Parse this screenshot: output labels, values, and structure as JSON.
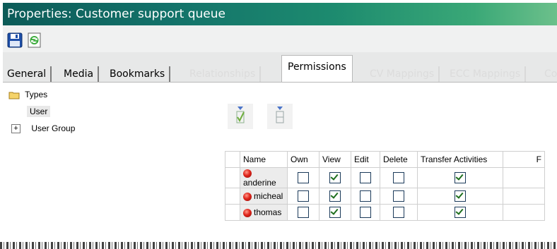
{
  "window": {
    "title": "Properties: Customer support queue"
  },
  "toolbar": {
    "save_icon": "save-icon",
    "refresh_icon": "refresh-icon"
  },
  "tabs": [
    {
      "label": "General",
      "state": "normal"
    },
    {
      "label": "Media",
      "state": "normal"
    },
    {
      "label": "Bookmarks",
      "state": "normal"
    },
    {
      "label": "Relationships",
      "state": "disabled"
    },
    {
      "label": "Permissions",
      "state": "active"
    },
    {
      "label": "CV Mappings",
      "state": "disabled"
    },
    {
      "label": "ECC Mappings",
      "state": "disabled"
    },
    {
      "label": "Co",
      "state": "disabled"
    }
  ],
  "tree": {
    "root": "Types",
    "items": [
      {
        "label": "User",
        "selected": true
      },
      {
        "label": "User Group",
        "expandable": true
      }
    ]
  },
  "grid": {
    "columns": [
      "",
      "Name",
      "Own",
      "View",
      "Edit",
      "Delete",
      "Transfer Activities",
      "F"
    ],
    "rows": [
      {
        "name": "anderine",
        "own": false,
        "view": true,
        "edit": false,
        "delete": false,
        "transfer": true
      },
      {
        "name": "micheal",
        "own": false,
        "view": true,
        "edit": false,
        "delete": false,
        "transfer": true
      },
      {
        "name": "thomas",
        "own": false,
        "view": true,
        "edit": false,
        "delete": false,
        "transfer": true
      }
    ]
  },
  "colors": {
    "title_bar_start": "#0c5b58",
    "title_bar_end": "#6cc08b",
    "status_dot": "#e0241b"
  }
}
